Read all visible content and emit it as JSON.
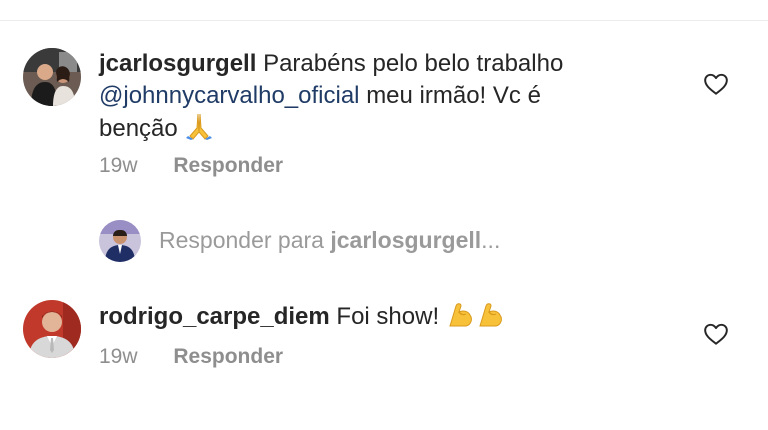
{
  "comments": [
    {
      "username": "jcarlosgurgell",
      "text_before": "Parabéns pelo belo trabalho",
      "mention": "@johnnycarvalho_oficial",
      "text_after": "meu irmão! Vc é",
      "text_line3": "benção",
      "emoji": "🙏",
      "emoji_icon": "praying-hands-icon",
      "time": "19w",
      "reply_label": "Responder"
    },
    {
      "username": "rodrigo_carpe_diem",
      "text": "Foi show!",
      "emoji": "💪💪",
      "emoji_icon": "flexed-biceps-icon",
      "time": "19w",
      "reply_label": "Responder"
    }
  ],
  "reply_prompt": {
    "prefix": "Responder para",
    "username": "jcarlosgurgell",
    "suffix": "..."
  },
  "colors": {
    "text": "#262626",
    "muted": "#8e8e8e",
    "mention": "#1f3b66",
    "divider": "#ececec"
  }
}
